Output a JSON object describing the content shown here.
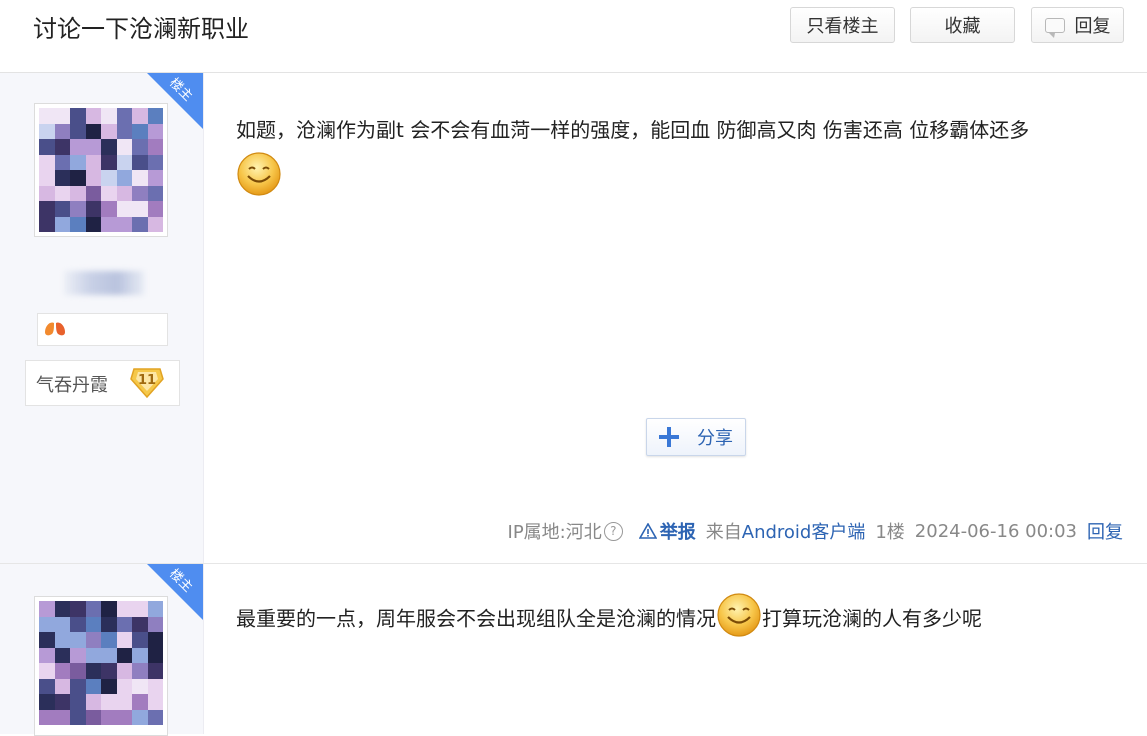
{
  "header": {
    "title": "讨论一下沧澜新职业",
    "buttons": {
      "only_op": "只看楼主",
      "favorite": "收藏",
      "reply": "回复"
    }
  },
  "posts": [
    {
      "corner_badge": "楼主",
      "author": {
        "level_name": "气吞丹霞",
        "level": "11"
      },
      "content": "如题，沧澜作为副t 会不会有血菏一样的强度，能回血 防御高又肉 伤害还高 位移霸体还多",
      "share_label": "分享",
      "meta": {
        "ip": "IP属地:河北",
        "help": "?",
        "report": "举报",
        "from_prefix": "来自",
        "client": "Android客户端",
        "floor": "1楼",
        "time": "2024-06-16 00:03",
        "reply": "回复"
      }
    },
    {
      "corner_badge": "楼主",
      "content_part1": "最重要的一点，周年服会不会出现组队全是沧澜的情况",
      "content_part2": "打算玩沧澜的人有多少呢"
    }
  ],
  "colors": {
    "accent_blue": "#2d64b3",
    "corner_blue": "#4f8df0",
    "sidebar_bg": "#f6f7fb"
  },
  "icons": [
    "smiley-emoji-icon",
    "lung-badge-icon",
    "level-diamond-icon",
    "share-plus-icon",
    "warning-triangle-icon",
    "question-icon",
    "speech-bubble-icon"
  ]
}
